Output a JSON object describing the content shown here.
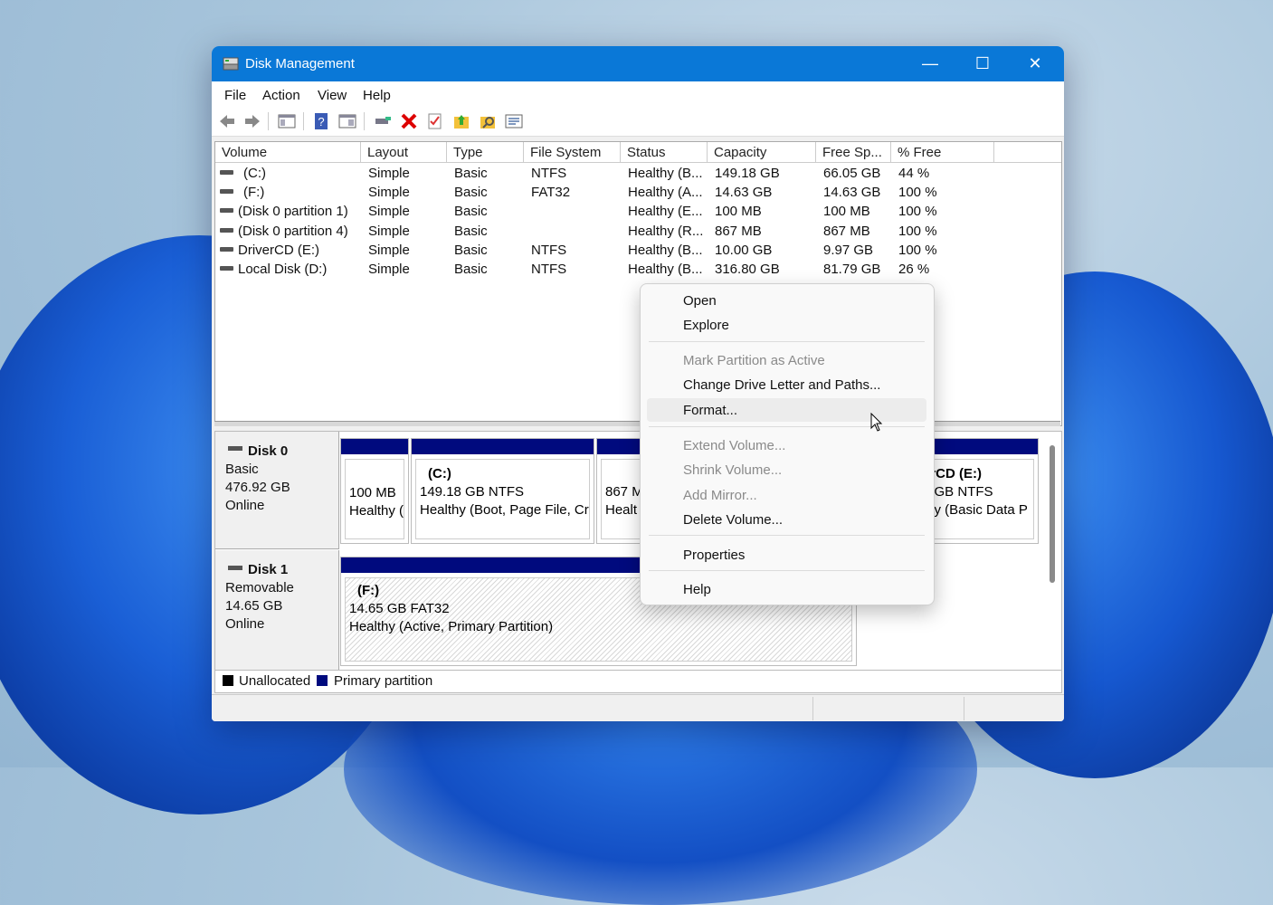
{
  "window": {
    "title": "Disk Management"
  },
  "menubar": [
    "File",
    "Action",
    "View",
    "Help"
  ],
  "toolbar_icons": [
    "back-arrow-icon",
    "forward-arrow-icon",
    "console-tree-icon",
    "help-icon",
    "properties-view-icon",
    "connect-icon",
    "delete-icon",
    "check-icon",
    "folder-up-icon",
    "folder-search-icon",
    "settings-list-icon"
  ],
  "volume_list": {
    "columns": [
      "Volume",
      "Layout",
      "Type",
      "File System",
      "Status",
      "Capacity",
      "Free Sp...",
      "% Free"
    ],
    "rows": [
      [
        "(C:)",
        "Simple",
        "Basic",
        "NTFS",
        "Healthy (B...",
        "149.18 GB",
        "66.05 GB",
        "44 %"
      ],
      [
        "(F:)",
        "Simple",
        "Basic",
        "FAT32",
        "Healthy (A...",
        "14.63 GB",
        "14.63 GB",
        "100 %"
      ],
      [
        "(Disk 0 partition 1)",
        "Simple",
        "Basic",
        "",
        "Healthy (E...",
        "100 MB",
        "100 MB",
        "100 %"
      ],
      [
        "(Disk 0 partition 4)",
        "Simple",
        "Basic",
        "",
        "Healthy (R...",
        "867 MB",
        "867 MB",
        "100 %"
      ],
      [
        "DriverCD (E:)",
        "Simple",
        "Basic",
        "NTFS",
        "Healthy (B...",
        "10.00 GB",
        "9.97 GB",
        "100 %"
      ],
      [
        "Local Disk (D:)",
        "Simple",
        "Basic",
        "NTFS",
        "Healthy (B...",
        "316.80 GB",
        "81.79 GB",
        "26 %"
      ]
    ]
  },
  "disks": [
    {
      "name": "Disk 0",
      "type": "Basic",
      "size": "476.92 GB",
      "state": "Online",
      "partitions": [
        {
          "l1": "",
          "l2": "100 MB",
          "l3": "Healthy ("
        },
        {
          "l1": "(C:)",
          "l2": "149.18 GB NTFS",
          "l3": "Healthy (Boot, Page File, Cra"
        },
        {
          "l1": "",
          "l2": "867 M",
          "l3": "Healt"
        },
        {
          "l1": "erCD  (E:)",
          "l2": "0 GB NTFS",
          "l3": "thy (Basic Data P"
        }
      ]
    },
    {
      "name": "Disk 1",
      "type": "Removable",
      "size": "14.65 GB",
      "state": "Online",
      "partitions": [
        {
          "l1": "(F:)",
          "l2": "14.65 GB FAT32",
          "l3": "Healthy (Active, Primary Partition)"
        }
      ]
    }
  ],
  "legend": {
    "unallocated": "Unallocated",
    "primary": "Primary partition",
    "colors": {
      "unallocated": "#000000",
      "primary": "#000a7e"
    }
  },
  "context_menu": {
    "items": [
      {
        "label": "Open",
        "enabled": true
      },
      {
        "label": "Explore",
        "enabled": true
      },
      {
        "label": "Mark Partition as Active",
        "enabled": false
      },
      {
        "label": "Change Drive Letter and Paths...",
        "enabled": true
      },
      {
        "label": "Format...",
        "enabled": true,
        "highlighted": true
      },
      {
        "label": "Extend Volume...",
        "enabled": false
      },
      {
        "label": "Shrink Volume...",
        "enabled": false
      },
      {
        "label": "Add Mirror...",
        "enabled": false
      },
      {
        "label": "Delete Volume...",
        "enabled": true
      },
      {
        "label": "Properties",
        "enabled": true
      },
      {
        "label": "Help",
        "enabled": true
      }
    ]
  },
  "colors": {
    "titlebar": "#0a78d7",
    "partition_bar": "#000a7e"
  }
}
